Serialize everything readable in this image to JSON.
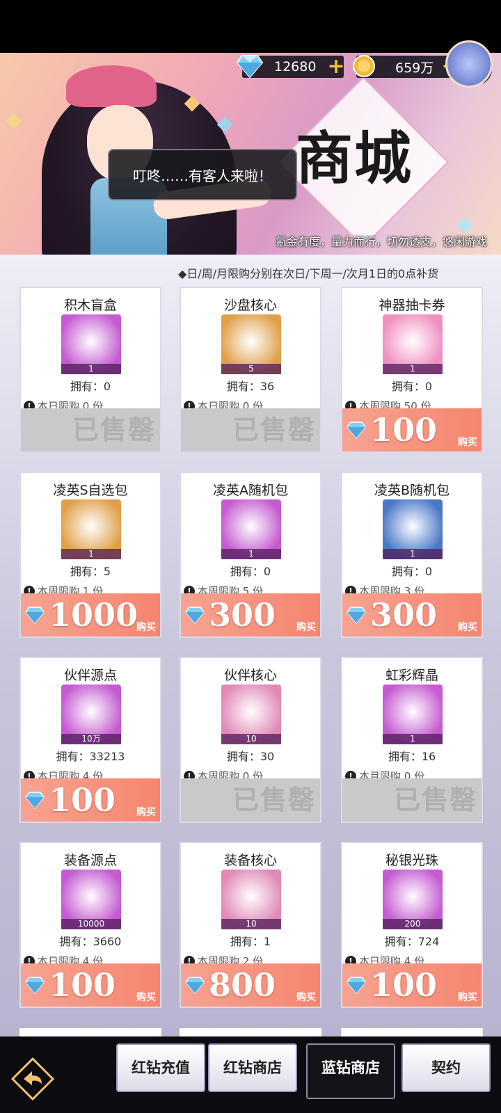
{
  "currency": {
    "blue_diamonds": "12680",
    "coins": "659万"
  },
  "help_label": "?",
  "banner": {
    "speech": "叮咚……有客人来啦！",
    "title": "商城",
    "tagline": "氪金有度，量力而行，切勿透支，悠闲游戏"
  },
  "notice": "◆日/周/月限购分别在次日/下周一/次月1日的0点补货",
  "sold_out_label": "已售罄",
  "buy_label": "购买",
  "items": [
    {
      "name": "积木盲盒",
      "qty": "1",
      "owned": "拥有：0",
      "limit": "本日限购 0 份",
      "status": "sold_out",
      "icon_color": "#c45bd1"
    },
    {
      "name": "沙盘核心",
      "qty": "5",
      "owned": "拥有：36",
      "limit": "本日限购 0 份",
      "status": "sold_out",
      "icon_color": "#e0a04a"
    },
    {
      "name": "神器抽卡券",
      "qty": "1",
      "owned": "拥有：0",
      "limit": "本周限购 50 份",
      "status": "buy",
      "price": "100",
      "icon_color": "#f08fc0"
    },
    {
      "name": "凌英S自选包",
      "qty": "1",
      "owned": "拥有：5",
      "limit": "本周限购 1 份",
      "status": "buy",
      "price": "1000",
      "icon_color": "#e0a04a"
    },
    {
      "name": "凌英A随机包",
      "qty": "1",
      "owned": "拥有：0",
      "limit": "本周限购 5 份",
      "status": "buy",
      "price": "300",
      "icon_color": "#c45bd1"
    },
    {
      "name": "凌英B随机包",
      "qty": "1",
      "owned": "拥有：0",
      "limit": "本周限购 3 份",
      "status": "buy",
      "price": "300",
      "icon_color": "#4a78c8"
    },
    {
      "name": "伙伴源点",
      "qty": "10万",
      "owned": "拥有：33213",
      "limit": "本日限购 4 份",
      "status": "buy",
      "price": "100",
      "icon_color": "#c45bd1"
    },
    {
      "name": "伙伴核心",
      "qty": "10",
      "owned": "拥有：30",
      "limit": "本周限购 0 份",
      "status": "sold_out",
      "icon_color": "#e08ab8"
    },
    {
      "name": "虹彩辉晶",
      "qty": "1",
      "owned": "拥有：16",
      "limit": "本月限购 0 份",
      "status": "sold_out",
      "icon_color": "#c45bd1"
    },
    {
      "name": "装备源点",
      "qty": "10000",
      "owned": "拥有：3660",
      "limit": "本日限购 4 份",
      "status": "buy",
      "price": "100",
      "icon_color": "#c45bd1"
    },
    {
      "name": "装备核心",
      "qty": "10",
      "owned": "拥有：1",
      "limit": "本周限购 2 份",
      "status": "buy",
      "price": "800",
      "icon_color": "#e08ab8"
    },
    {
      "name": "秘银光珠",
      "qty": "200",
      "owned": "拥有：724",
      "limit": "本日限购 4 份",
      "status": "buy",
      "price": "100",
      "icon_color": "#c45bd1"
    }
  ],
  "tabs": [
    {
      "label": "红钻充值",
      "active": false
    },
    {
      "label": "红钻商店",
      "active": false
    },
    {
      "label": "蓝钻商店",
      "active": true
    },
    {
      "label": "契约",
      "active": false
    }
  ],
  "colors": {
    "buy_bg": "#f6856f",
    "sold_out_bg": "#c9c9cc",
    "currency_accent": "#f5c42b"
  }
}
